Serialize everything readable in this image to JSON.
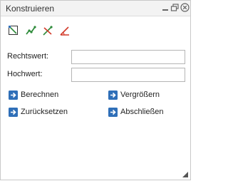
{
  "window": {
    "title": "Konstruieren",
    "controls": {
      "minimize": "minimize-icon",
      "restore": "restore-icon",
      "close": "close-icon"
    }
  },
  "toolbar": {
    "tools": [
      {
        "icon": "draw-line-tool-icon"
      },
      {
        "icon": "polyline-tool-icon"
      },
      {
        "icon": "intersection-tool-icon"
      },
      {
        "icon": "angle-tool-icon"
      }
    ]
  },
  "form": {
    "easting_label": "Rechtswert:",
    "easting_value": "",
    "northing_label": "Hochwert:",
    "northing_value": ""
  },
  "actions": {
    "calculate": "Berechnen",
    "zoom": "Vergrößern",
    "reset": "Zurücksetzen",
    "finish": "Abschließen"
  },
  "colors": {
    "accent_blue": "#2f6fb8",
    "tool_green": "#2e8b3a",
    "tool_red": "#d23a2a"
  }
}
